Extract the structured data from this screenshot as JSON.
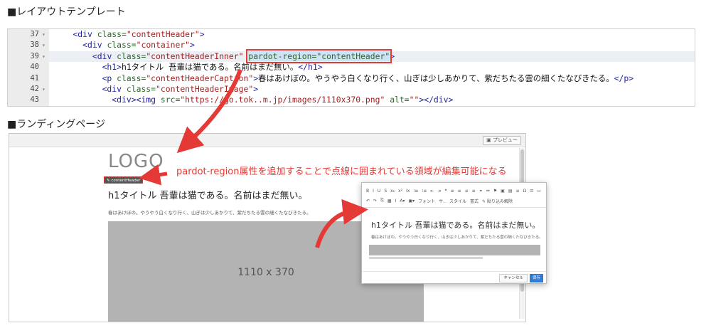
{
  "sections": {
    "layout_template": "■レイアウトテンプレート",
    "landing_page": "■ランディングページ"
  },
  "code": {
    "lines": [
      {
        "num": "37",
        "fold": "▾",
        "indent": "    ",
        "parts": [
          [
            "tg",
            "<div "
          ],
          [
            "at",
            "class="
          ],
          [
            "sv",
            "\"contentHeader\""
          ],
          [
            "tg",
            ">"
          ]
        ]
      },
      {
        "num": "38",
        "fold": "▾",
        "indent": "      ",
        "parts": [
          [
            "tg",
            "<div "
          ],
          [
            "at",
            "class="
          ],
          [
            "sv",
            "\"container\""
          ],
          [
            "tg",
            ">"
          ]
        ]
      },
      {
        "num": "39",
        "fold": "▾",
        "indent": "        ",
        "parts": [
          [
            "tg",
            "<div "
          ],
          [
            "at",
            "class="
          ],
          [
            "sv",
            "\"contentHeaderInner\""
          ],
          [
            "tg",
            " "
          ]
        ],
        "selected": "pardot-region=\"contentHeader\"",
        "after": ">"
      },
      {
        "num": "40",
        "fold": "",
        "indent": "          ",
        "parts": [
          [
            "tg",
            "<h1>"
          ],
          [
            "txt",
            "h1タイトル 吾輩は猫である。名前はまだ無い。"
          ],
          [
            "tg",
            "</h1>"
          ]
        ]
      },
      {
        "num": "41",
        "fold": "",
        "indent": "          ",
        "parts": [
          [
            "tg",
            "<p "
          ],
          [
            "at",
            "class="
          ],
          [
            "sv",
            "\"contentHeaderCaption\""
          ],
          [
            "tg",
            ">"
          ],
          [
            "txt",
            "春はあけぼの。やうやう白くなり行く、山ぎは少しあかりて、紫だちたる雲の細くたなびきたる。"
          ],
          [
            "tg",
            "</p>"
          ]
        ]
      },
      {
        "num": "42",
        "fold": "▾",
        "indent": "          ",
        "parts": [
          [
            "tg",
            "<div "
          ],
          [
            "at",
            "class="
          ],
          [
            "sv",
            "\"contentHeaderImage\""
          ],
          [
            "tg",
            ">"
          ]
        ]
      },
      {
        "num": "43",
        "fold": "",
        "indent": "            ",
        "parts": [
          [
            "tg",
            "<div><img "
          ],
          [
            "at",
            "src="
          ],
          [
            "sv",
            "\"https://go.tok..m.jp/images/1110x370.png\""
          ],
          [
            "at",
            " alt="
          ],
          [
            "sv",
            "\"\""
          ],
          [
            "tg",
            "></div>"
          ]
        ]
      }
    ]
  },
  "landing": {
    "preview_label": "プレビュー",
    "logo": "LOGO",
    "region_badge": "contentHeader",
    "h1": "h1タイトル 吾輩は猫である。名前はまだ無い。",
    "caption": "春はあけぼの。やうやう白くなり行く、山ぎは少しあかりて、紫だちたる雲の細くたなびきたる。",
    "image_label": "1110 x 370"
  },
  "annotation": "pardot-region属性を追加することで点線に囲まれている領域が編集可能になる",
  "editor": {
    "toolbar1": [
      "B",
      "I",
      "U",
      "S",
      "x₂",
      "x²",
      "Ix",
      "⁝≡",
      "⁝≡",
      "⇤",
      "⇥",
      "❝",
      "≡",
      "≡",
      "≡",
      "≡",
      "⚭",
      "⚮",
      "⚑",
      "▣",
      "▤",
      "≡",
      "Ω",
      "⊡",
      "▭"
    ],
    "toolbar2": [
      "↶",
      "↷",
      "⎘",
      "▦",
      "I",
      "A▾",
      "▣▾",
      "フォント",
      "サ..",
      "スタイル",
      "書式",
      "✎ 貼り込み解除"
    ],
    "h1": "h1タイトル 吾輩は猫である。名前はまだ無い。",
    "caption": "春はあけぼの。やうやう白くなり行く、山ぎは少しあかりて、紫だちたる雲の細くたなびきたる。",
    "cancel_label": "キャンセル",
    "save_label": "保存"
  },
  "colors": {
    "accent_red": "#e53935",
    "save_blue": "#2f7bd6"
  }
}
